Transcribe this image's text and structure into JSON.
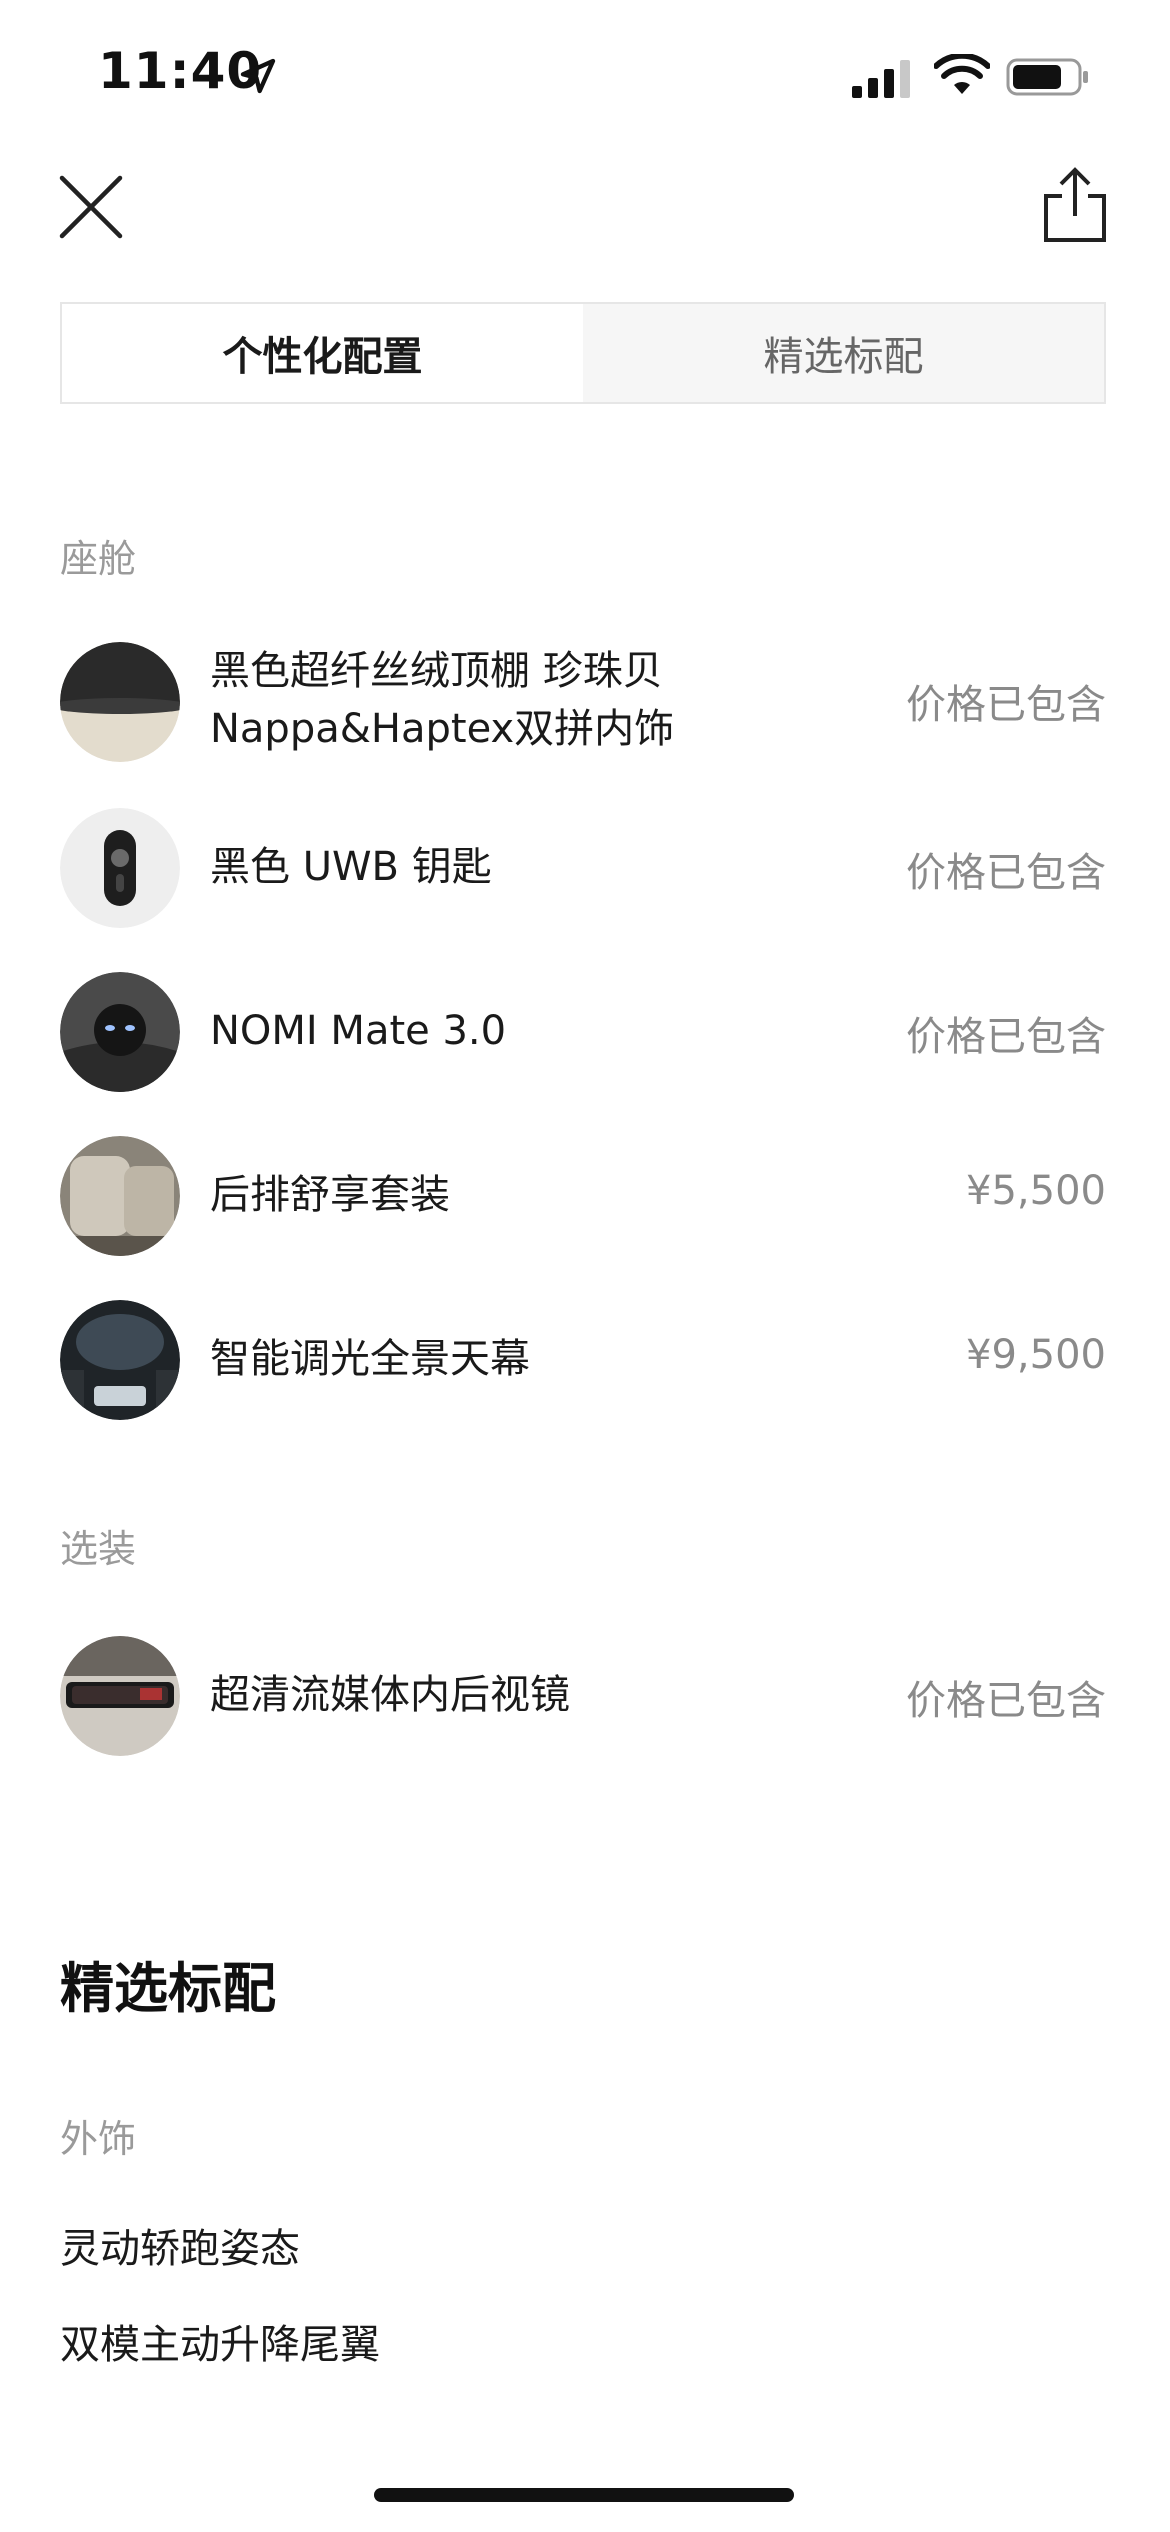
{
  "status_bar": {
    "time": "11:40"
  },
  "tabs": [
    {
      "label": "个性化配置",
      "active": true
    },
    {
      "label": "精选标配",
      "active": false
    }
  ],
  "cabin": {
    "label": "座舱",
    "items": [
      {
        "name_line1": "黑色超纤丝绒顶棚 珍珠贝",
        "name_line2": "Nappa&Haptex双拼内饰",
        "price": "价格已包含",
        "icon": "interior-swatch-icon"
      },
      {
        "name_line1": "黑色 UWB 钥匙",
        "price": "价格已包含",
        "icon": "key-fob-icon"
      },
      {
        "name_line1": "NOMI Mate 3.0",
        "price": "价格已包含",
        "icon": "nomi-mate-icon"
      },
      {
        "name_line1": "后排舒享套装",
        "price": "¥5,500",
        "icon": "rear-seat-icon"
      },
      {
        "name_line1": "智能调光全景天幕",
        "price": "¥9,500",
        "icon": "panoramic-roof-icon"
      }
    ]
  },
  "optional": {
    "label": "选装",
    "items": [
      {
        "name_line1": "超清流媒体内后视镜",
        "price": "价格已包含",
        "icon": "rearview-mirror-icon"
      }
    ]
  },
  "standard": {
    "title": "精选标配",
    "exterior_label": "外饰",
    "items": [
      "灵动轿跑姿态",
      "双模主动升降尾翼"
    ]
  }
}
